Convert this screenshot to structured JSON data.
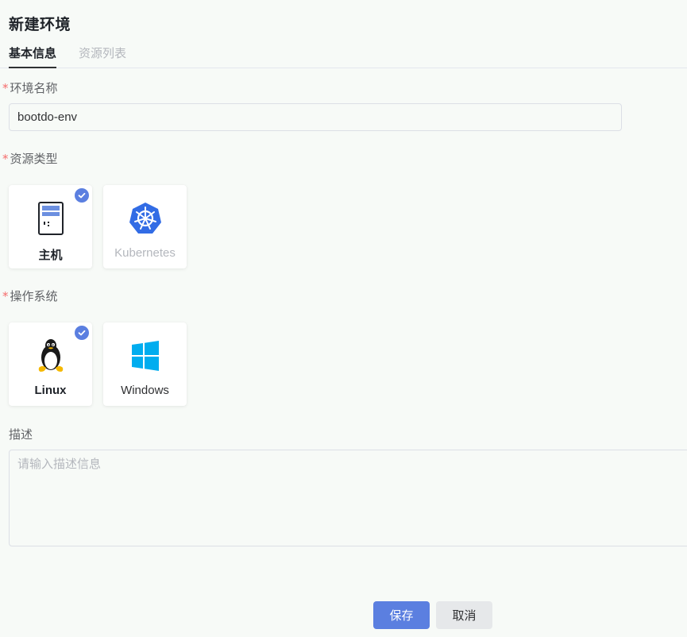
{
  "page": {
    "title": "新建环境"
  },
  "tabs": [
    {
      "label": "基本信息",
      "active": true
    },
    {
      "label": "资源列表",
      "active": false
    }
  ],
  "form": {
    "env_name": {
      "label": "环境名称",
      "required_mark": "*",
      "value": "bootdo-env"
    },
    "resource_type": {
      "label": "资源类型",
      "required_mark": "*",
      "options": [
        {
          "label": "主机",
          "icon": "server-icon",
          "selected": true,
          "disabled": false
        },
        {
          "label": "Kubernetes",
          "icon": "kubernetes-icon",
          "selected": false,
          "disabled": true
        }
      ]
    },
    "os": {
      "label": "操作系统",
      "required_mark": "*",
      "options": [
        {
          "label": "Linux",
          "icon": "linux-tux-icon",
          "selected": true
        },
        {
          "label": "Windows",
          "icon": "windows-icon",
          "selected": false
        }
      ]
    },
    "description": {
      "label": "描述",
      "placeholder": "请输入描述信息",
      "value": ""
    }
  },
  "actions": {
    "save_label": "保存",
    "cancel_label": "取消"
  },
  "colors": {
    "primary": "#5b7fe0",
    "required": "#f56c6c",
    "background": "#f7faf7",
    "kubernetes_blue": "#326ce5",
    "windows_blue": "#00adef"
  }
}
